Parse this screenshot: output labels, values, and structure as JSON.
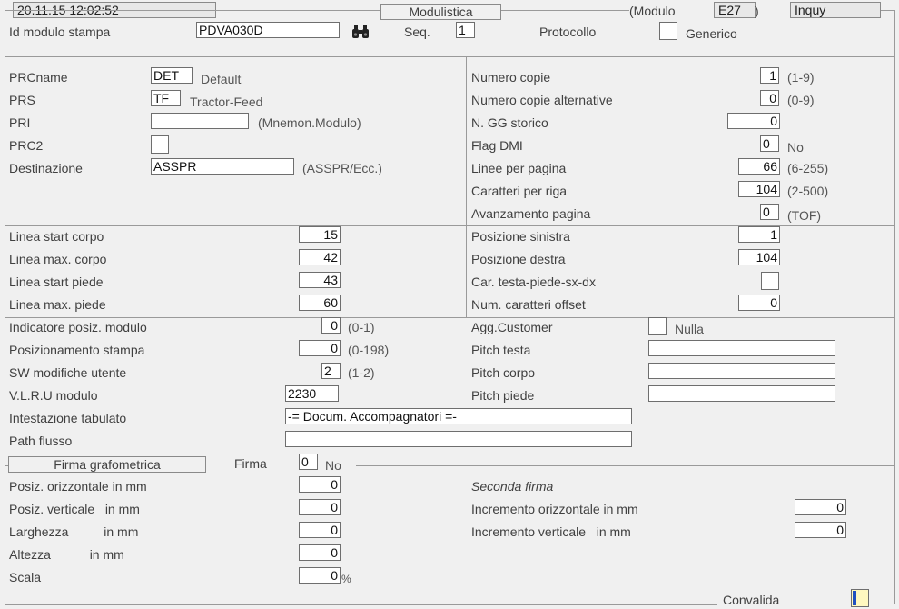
{
  "header": {
    "datetime": "20.11.15 12:02:52",
    "title": "Modulistica",
    "module_label": "(Modulo",
    "module_code": "E27",
    "module_close": ")",
    "mode": "Inquy"
  },
  "top": {
    "id_label": "Id modulo stampa",
    "id_value": "PDVA030D",
    "seq_label": "Seq.",
    "seq_value": "1",
    "protocollo_label": "Protocollo",
    "generico_label": "Generico"
  },
  "left1": {
    "prcname_label": "PRCname",
    "prcname_value": "DET",
    "prcname_desc": "Default",
    "prs_label": "PRS",
    "prs_value": "TF",
    "prs_desc": "Tractor-Feed",
    "pri_label": "PRI",
    "pri_value": "",
    "pri_hint": "(Mnemon.Modulo)",
    "prc2_label": "PRC2",
    "dest_label": "Destinazione",
    "dest_value": "ASSPR",
    "dest_hint": "(ASSPR/Ecc.)"
  },
  "right1": {
    "ncopie_label": "Numero copie",
    "ncopie_value": "1",
    "ncopie_hint": "(1-9)",
    "ncopiealt_label": "Numero copie alternative",
    "ncopiealt_value": "0",
    "ncopiealt_hint": "(0-9)",
    "ngg_label": "N. GG storico",
    "ngg_value": "0",
    "dmi_label": "Flag DMI",
    "dmi_value": "0",
    "dmi_desc": "No",
    "linee_label": "Linee per pagina",
    "linee_value": "66",
    "linee_hint": "(6-255)",
    "car_label": "Caratteri per riga",
    "car_value": "104",
    "car_hint": "(2-500)",
    "avanz_label": "Avanzamento pagina",
    "avanz_value": "0",
    "avanz_hint": "(TOF)"
  },
  "left2": {
    "lsc_label": "Linea start corpo",
    "lsc_value": "15",
    "lmc_label": "Linea max.  corpo",
    "lmc_value": "42",
    "lsp_label": "Linea start piede",
    "lsp_value": "43",
    "lmp_label": "Linea max.  piede",
    "lmp_value": "60"
  },
  "right2": {
    "possx_label": "Posizione sinistra",
    "possx_value": "1",
    "posdx_label": "Posizione destra",
    "posdx_value": "104",
    "cartp_label": "Car. testa-piede-sx-dx",
    "cartp_value": "",
    "numoff_label": "Num. caratteri offset",
    "numoff_value": "0"
  },
  "left3": {
    "ipm_label": "Indicatore posiz. modulo",
    "ipm_value": "0",
    "ipm_hint": "(0-1)",
    "ps_label": "Posizionamento stampa",
    "ps_value": "0",
    "ps_hint": "(0-198)",
    "sw_label": "SW modifiche utente",
    "sw_value": "2",
    "sw_hint": "(1-2)",
    "vlru_label": "V.L.R.U modulo",
    "vlru_value": "2230",
    "int_label": "Intestazione tabulato",
    "int_value": "-= Docum. Accompagnatori =-",
    "path_label": "Path flusso",
    "path_value": ""
  },
  "right3": {
    "agg_label": "Agg.Customer",
    "agg_desc": "Nulla",
    "pt_label": "Pitch testa",
    "pt_value": "",
    "pc_label": "Pitch corpo",
    "pc_value": "",
    "pp_label": "Pitch piede",
    "pp_value": ""
  },
  "firma": {
    "section_title": "Firma grafometrica",
    "firma_label": "Firma",
    "firma_value": "0",
    "firma_desc": "No",
    "po_label": "Posiz. orizzontale in mm",
    "po_value": "0",
    "pv_label": "Posiz. verticale   in mm",
    "pv_value": "0",
    "larg_label": "Larghezza          in mm",
    "larg_value": "0",
    "alt_label": "Altezza           in mm",
    "alt_value": "0",
    "scala_label": "Scala",
    "scala_value": "0",
    "scala_unit": "%",
    "seconda_label": "Seconda firma",
    "io_label": "Incremento orizzontale in mm",
    "io_value": "0",
    "iv_label": "Incremento verticale   in mm",
    "iv_value": "0"
  },
  "footer": {
    "convalida_label": "Convalida"
  }
}
